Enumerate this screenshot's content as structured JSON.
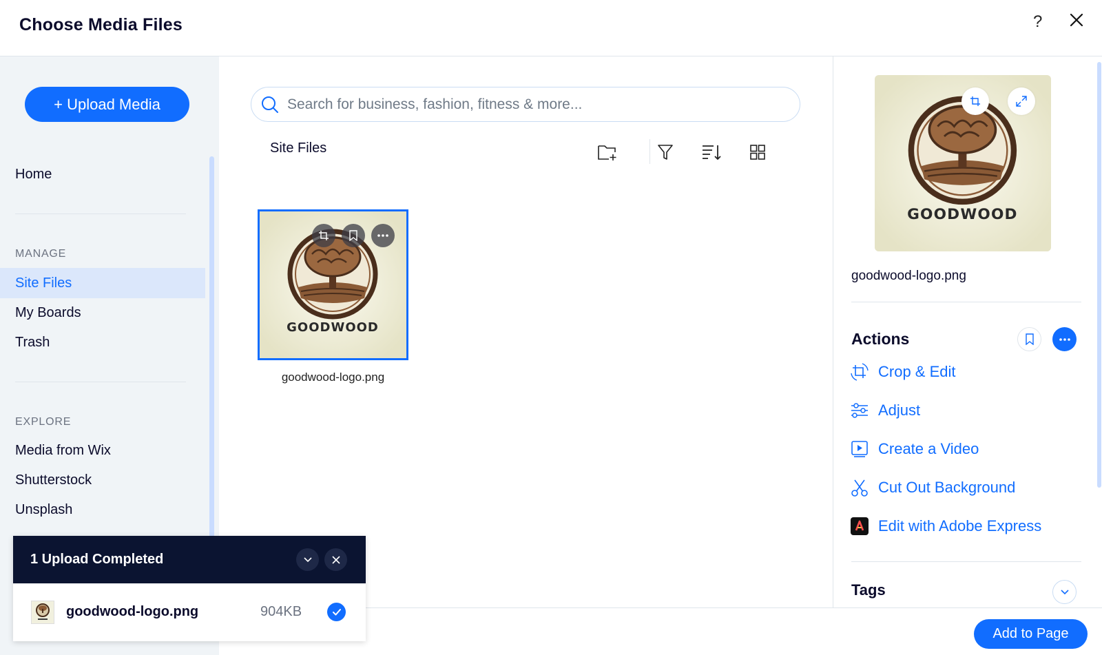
{
  "header": {
    "title": "Choose Media Files",
    "help_label": "?"
  },
  "sidebar": {
    "upload_label": "+ Upload Media",
    "home_label": "Home",
    "manage_label": "MANAGE",
    "manage_items": [
      {
        "label": "Site Files",
        "active": true
      },
      {
        "label": "My Boards",
        "active": false
      },
      {
        "label": "Trash",
        "active": false
      }
    ],
    "explore_label": "EXPLORE",
    "explore_items": [
      {
        "label": "Media from Wix"
      },
      {
        "label": "Shutterstock"
      },
      {
        "label": "Unsplash"
      }
    ]
  },
  "main": {
    "search_placeholder": "Search for business, fashion, fitness & more...",
    "breadcrumb": "Site Files",
    "files": [
      {
        "name": "goodwood-logo.png",
        "logo_text": "GOODWOOD",
        "selected": true
      }
    ]
  },
  "info": {
    "file_name": "goodwood-logo.png",
    "logo_text": "GOODWOOD",
    "actions_title": "Actions",
    "actions": [
      {
        "label": "Crop & Edit",
        "icon": "crop-edit-icon"
      },
      {
        "label": "Adjust",
        "icon": "adjust-sliders-icon"
      },
      {
        "label": "Create a Video",
        "icon": "video-icon"
      },
      {
        "label": "Cut Out Background",
        "icon": "scissors-icon"
      },
      {
        "label": "Edit with Adobe Express",
        "icon": "adobe-express-icon"
      }
    ],
    "tags_title": "Tags"
  },
  "footer": {
    "add_label": "Add to Page"
  },
  "toast": {
    "title": "1 Upload Completed",
    "file_name": "goodwood-logo.png",
    "file_size": "904KB"
  },
  "colors": {
    "accent": "#116dff",
    "toast_bg": "#0b1431",
    "sidebar_bg": "#f0f4f7",
    "active_bg": "#dbe7fb"
  }
}
